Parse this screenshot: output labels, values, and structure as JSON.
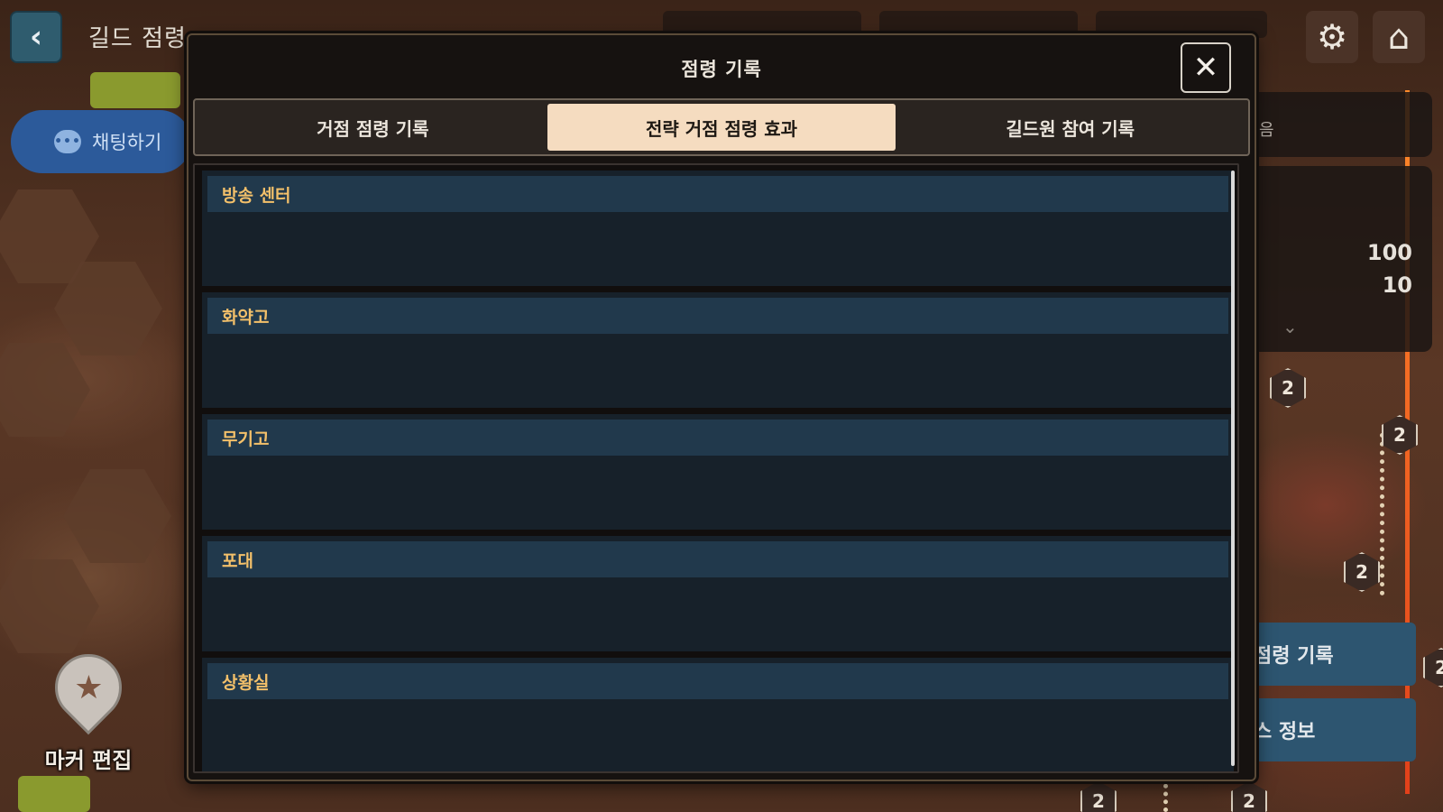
{
  "screen": {
    "back_icon": "chevron-left-icon",
    "title": "길드 점령",
    "chat_label": "채팅하기",
    "marker_edit_label": "마커 편집",
    "settings_icon": "gear-icon",
    "home_icon": "home-icon"
  },
  "side_panel": {
    "partial_text": "음",
    "values": [
      "100",
      "10"
    ],
    "buttons": [
      "점령 기록",
      "스 정보"
    ]
  },
  "map": {
    "badges": [
      "2",
      "2",
      "2",
      "2",
      "2",
      "2"
    ]
  },
  "modal": {
    "title": "점령 기록",
    "close_icon": "close-icon",
    "tabs": [
      {
        "label": "거점 점령 기록",
        "active": false
      },
      {
        "label": "전략 거점 점령 효과",
        "active": true
      },
      {
        "label": "길드원 참여 기록",
        "active": false
      }
    ],
    "effects": [
      {
        "name": "방송 센터"
      },
      {
        "name": "화약고"
      },
      {
        "name": "무기고"
      },
      {
        "name": "포대"
      },
      {
        "name": "상황실"
      }
    ]
  },
  "colors": {
    "active_tab_bg": "#f5dcc0",
    "card_header_bg": "#21394c",
    "card_title": "#f3c06a",
    "modal_bg": "#161210"
  }
}
